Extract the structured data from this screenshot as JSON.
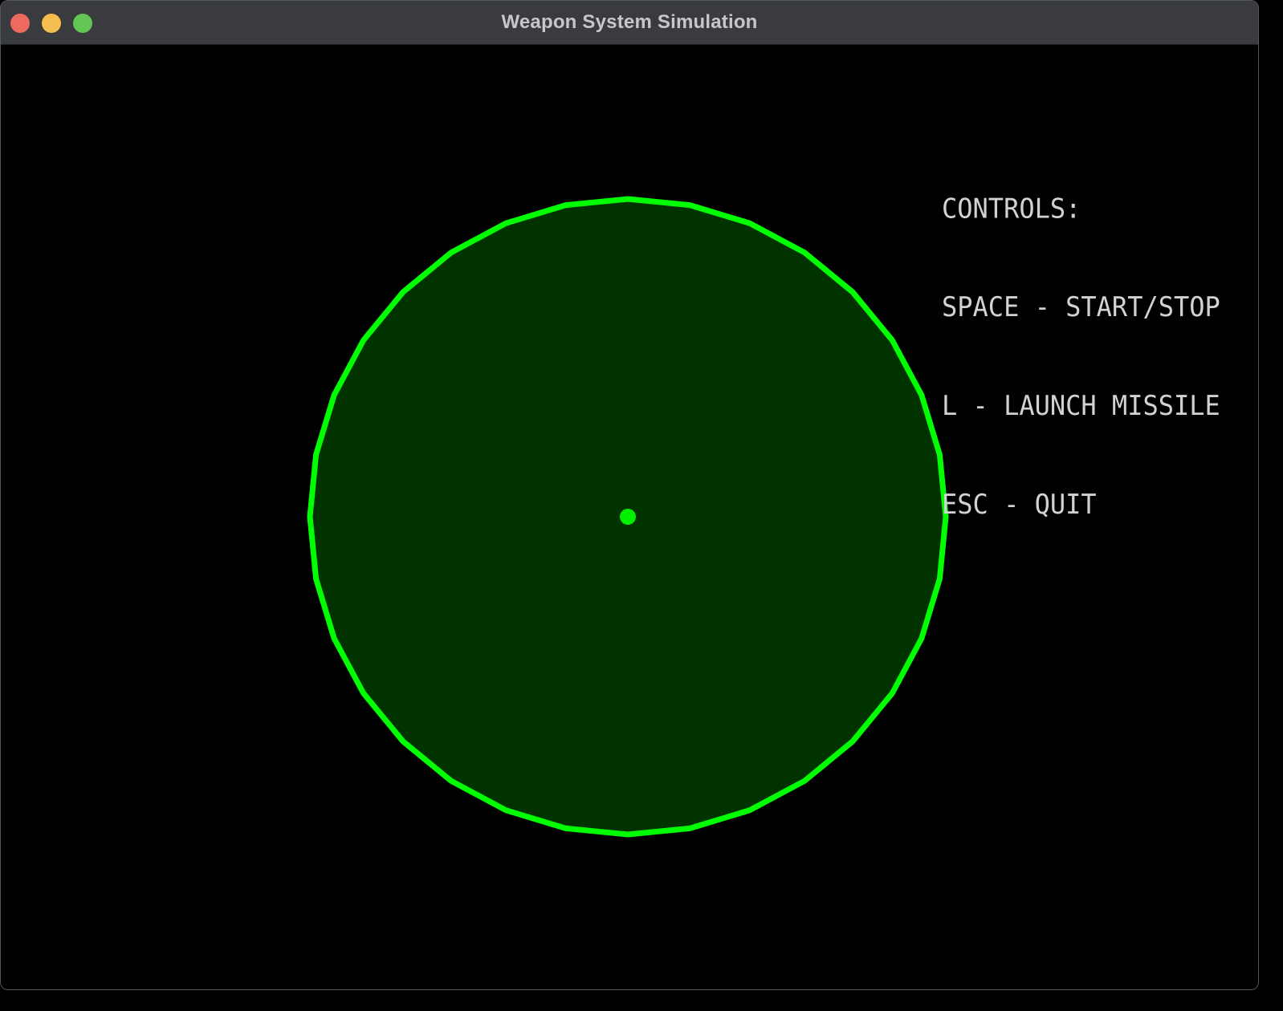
{
  "window": {
    "title": "Weapon System Simulation",
    "traffic_lights": {
      "close_color": "#ee6a5f",
      "minimize_color": "#f5be4f",
      "zoom_color": "#62c554"
    }
  },
  "radar": {
    "ring_color": "#00ff00",
    "fill_color": "#003300",
    "center_dot_color": "#00ee00",
    "ring_segments": 32
  },
  "controls": {
    "heading": "CONTROLS:",
    "lines": [
      "SPACE - START/STOP",
      "L - LAUNCH MISSILE",
      "ESC - QUIT"
    ]
  }
}
